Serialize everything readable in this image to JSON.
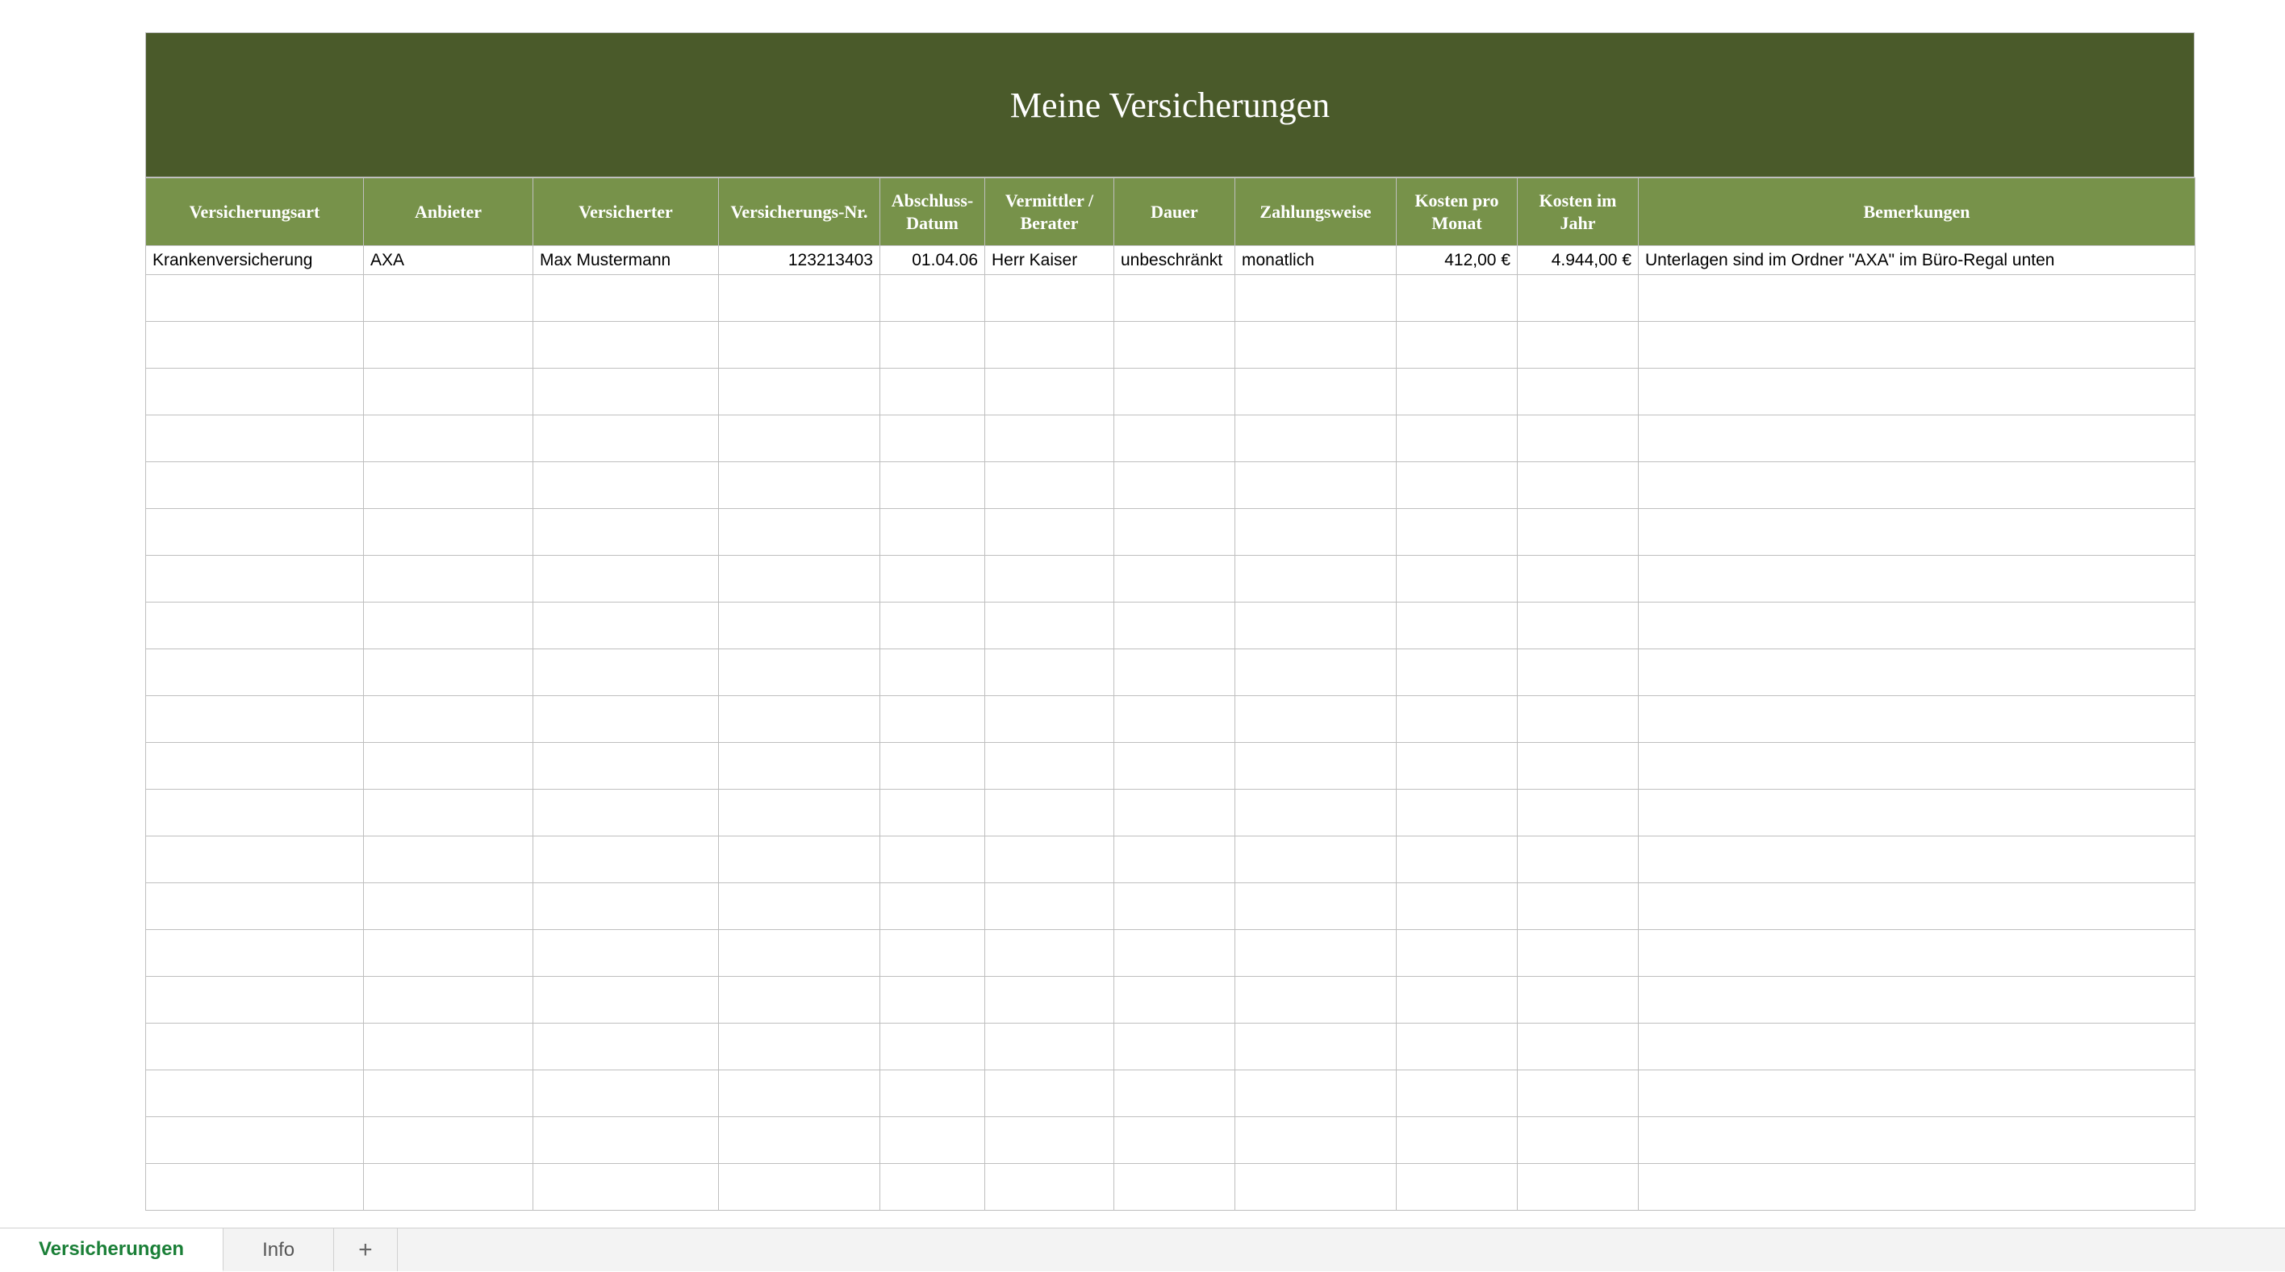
{
  "title": "Meine Versicherungen",
  "columns": [
    "Versicherungsart",
    "Anbieter",
    "Versicherter",
    "Versicherungs-Nr.",
    "Abschluss-Datum",
    "Vermittler / Berater",
    "Dauer",
    "Zahlungsweise",
    "Kosten pro Monat",
    "Kosten im Jahr",
    "Bemerkungen"
  ],
  "rows": [
    {
      "art": "Krankenversicherung",
      "anbieter": "AXA",
      "versicherter": "Max Mustermann",
      "nr": "123213403",
      "datum": "01.04.06",
      "vermittler": "Herr Kaiser",
      "dauer": "unbeschränkt",
      "zahlungsweise": "monatlich",
      "kosten_monat": "412,00 €",
      "kosten_jahr": "4.944,00 €",
      "bemerkungen": "Unterlagen sind im Ordner \"AXA\" im Büro-Regal unten"
    }
  ],
  "empty_row_count": 20,
  "tabs": {
    "active": "Versicherungen",
    "others": [
      "Info"
    ],
    "add_icon": "+"
  }
}
